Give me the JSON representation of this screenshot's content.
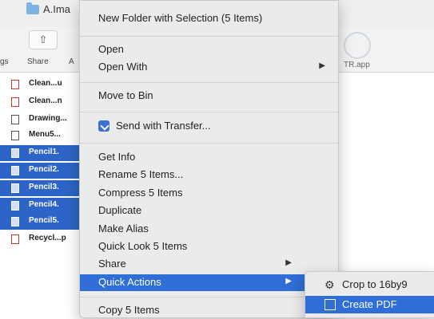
{
  "window": {
    "title": "A.Ima"
  },
  "toolbar": {
    "share_label": "Share",
    "tags_label": "gs",
    "a_label": "A",
    "share_glyph": "⇧",
    "bg_app_label": "TR.app"
  },
  "files": [
    {
      "name": "Clean...u",
      "selected": false,
      "icon": "pdf-icon"
    },
    {
      "name": "Clean...n",
      "selected": false,
      "icon": "pdf-icon"
    },
    {
      "name": "Drawing...",
      "selected": false,
      "icon": "doc-icon"
    },
    {
      "name": "Menu5...",
      "selected": false,
      "icon": "doc-icon"
    },
    {
      "name": "Pencil1.",
      "selected": true,
      "icon": "image-icon"
    },
    {
      "name": "Pencil2.",
      "selected": true,
      "icon": "image-icon"
    },
    {
      "name": "Pencil3.",
      "selected": true,
      "icon": "image-icon"
    },
    {
      "name": "Pencil4.",
      "selected": true,
      "icon": "image-icon"
    },
    {
      "name": "Pencil5.",
      "selected": true,
      "icon": "image-icon"
    },
    {
      "name": "Recycl...p",
      "selected": false,
      "icon": "pdf-icon"
    }
  ],
  "menu": {
    "new_folder": "New Folder with Selection (5 Items)",
    "open": "Open",
    "open_with": "Open With",
    "move_to_bin": "Move to Bin",
    "send_with_transfer": "Send with Transfer...",
    "get_info": "Get Info",
    "rename": "Rename 5 Items...",
    "compress": "Compress 5 Items",
    "duplicate": "Duplicate",
    "make_alias": "Make Alias",
    "quick_look": "Quick Look 5 Items",
    "share": "Share",
    "quick_actions": "Quick Actions",
    "copy": "Copy 5 Items",
    "submenu_arrow": "▶"
  },
  "submenu": {
    "crop": "Crop to 16by9",
    "create_pdf": "Create PDF"
  },
  "colors": {
    "highlight": "#2f6ed6",
    "selection": "#2d64c8",
    "menu_bg": "#ebebeb"
  }
}
